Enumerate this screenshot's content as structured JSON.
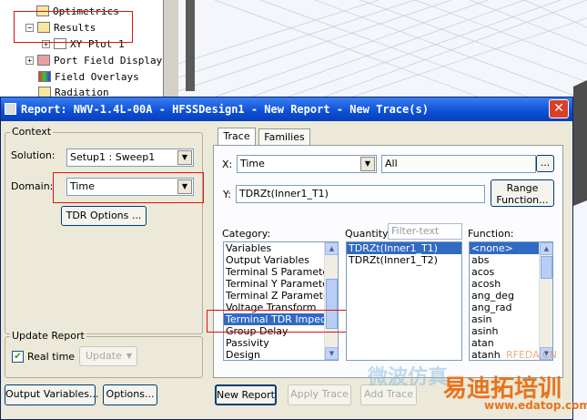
{
  "tree": {
    "items": [
      {
        "label": "Optimetrics",
        "expander": ""
      },
      {
        "label": "Results",
        "expander": "−"
      },
      {
        "label": "XY Plot 1",
        "expander": "+"
      },
      {
        "label": "Port Field Display",
        "expander": "+"
      },
      {
        "label": "Field Overlays",
        "expander": ""
      },
      {
        "label": "Radiation",
        "expander": ""
      }
    ]
  },
  "dialog": {
    "title": "Report: NWV-1.4L-00A - HFSSDesign1 - New Report - New Trace(s)",
    "close": "✕",
    "context": {
      "label": "Context",
      "solution_label": "Solution:",
      "solution_value": "Setup1 : Sweep1",
      "domain_label": "Domain:",
      "domain_value": "Time",
      "tdr_button": "TDR Options ..."
    },
    "update": {
      "label": "Update Report",
      "realtime_label": "Real time",
      "realtime_checked": true,
      "update_button": "Update"
    },
    "tabs": [
      "Trace",
      "Families"
    ],
    "x_label": "X:",
    "x_value": "Time",
    "x_range": "All",
    "x_ellipsis": "...",
    "y_label": "Y:",
    "y_value": "TDRZt(Inner1_T1)",
    "range_button": "Range\nFunction...",
    "category": {
      "label": "Category:",
      "items": [
        "Variables",
        "Output Variables",
        "Terminal S Parameter",
        "Terminal Y Parameter",
        "Terminal Z Parameter",
        "Voltage Transform",
        "Terminal TDR Impedan",
        "Group Delay",
        "Passivity",
        "Design"
      ],
      "selected": 6
    },
    "quantity": {
      "label": "Quantity:",
      "filter_placeholder": "Filter-text",
      "items": [
        "TDRZt(Inner1_T1)",
        "TDRZt(Inner1_T2)"
      ],
      "selected": 0
    },
    "function": {
      "label": "Function:",
      "items": [
        "<none>",
        "abs",
        "acos",
        "acosh",
        "ang_deg",
        "ang_rad",
        "asin",
        "asinh",
        "atan",
        "atanh"
      ],
      "selected": 0
    },
    "buttons": {
      "output_variables": "Output Variables...",
      "options": "Options...",
      "new_report": "New Report",
      "apply_trace": "Apply Trace",
      "add_trace": "Add Trace"
    }
  },
  "watermark": {
    "cn1": "易迪拓培训",
    "cn2": "微波仿真",
    "url": "www.edatop.com",
    "brand": "RFEDA.CN"
  }
}
